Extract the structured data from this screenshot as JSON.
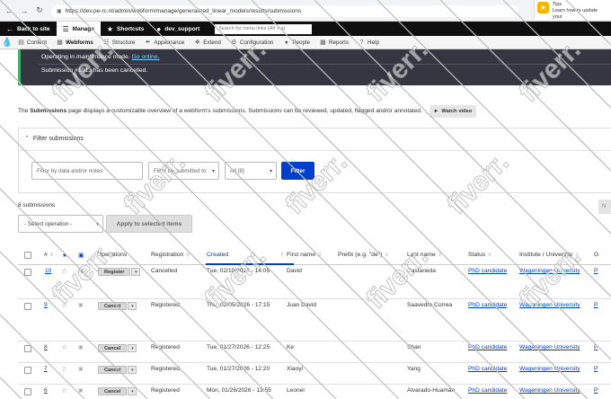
{
  "browser": {
    "url": "https://dev.pe-rc.nl/admin/webform/manage/generalized_linear_models/results/submissions",
    "notification": {
      "title": "Tips",
      "text": "Learn how to update your"
    }
  },
  "toolbar": {
    "back": "Back to site",
    "manage": "Manage",
    "shortcuts": "Shortcuts",
    "user": "dev_support",
    "search_placeholder": "Search for menu links (Alt + a)"
  },
  "tray": {
    "items": [
      "Content",
      "Webforms",
      "Structure",
      "Appearance",
      "Extend",
      "Configuration",
      "People",
      "Reports",
      "Help"
    ],
    "active": "Webforms"
  },
  "messages": {
    "maintenance": "Operating in maintenance mode.",
    "maintenance_link": "Go online.",
    "cancelled": "Submission #1913 has been cancelled."
  },
  "description": {
    "prefix": "The ",
    "bold": "Submissions",
    "text": " page displays a customizable overview of a webform's submissions. Submissions can be reviewed, updated, flagged and/or annotated.",
    "watch": "Watch video"
  },
  "filter": {
    "title": "Filter submissions",
    "keys_placeholder": "Filter by data and/or notes",
    "submitted_to": "Filter by submitted to",
    "state": "All [8]",
    "button": "Filter"
  },
  "count": "8 submissions",
  "bulk": {
    "operation": "- Select operation -",
    "apply": "Apply to selected items"
  },
  "right_stub": "N",
  "columns": [
    "#",
    "Operations",
    "Registration",
    "Created",
    "First name",
    "Prefix (e.g. \"de\")",
    "Last name",
    "Status",
    "Institute / University",
    "G"
  ],
  "rows": [
    {
      "sid": "10",
      "op": "Register",
      "registration": "Cancelled",
      "created": "Tue, 02/10/2026 - 14:05",
      "first": "David",
      "prefix": "",
      "last": "Castaneda",
      "status": "PhD candidate",
      "institute": "Wageningen University",
      "g": "P"
    },
    {
      "sid": "9",
      "op": "Cancel",
      "registration": "Registered",
      "created": "Thu, 02/05/2026 - 17:15",
      "first": "Juan David",
      "prefix": "",
      "last": "Saavedra Correa",
      "status": "PhD candidate",
      "institute": "Wageningen University",
      "g": "P"
    },
    {
      "sid": "8",
      "op": "Cancel",
      "registration": "Registered",
      "created": "Tue, 01/27/2026 - 12:25",
      "first": "Ke",
      "prefix": "",
      "last": "Shan",
      "status": "PhD candidate",
      "institute": "Wageningen University",
      "g": "P"
    },
    {
      "sid": "7",
      "op": "Cancel",
      "registration": "Registered",
      "created": "Tue, 01/27/2026 - 12:20",
      "first": "Xiaoyi",
      "prefix": "",
      "last": "Yang",
      "status": "PhD candidate",
      "institute": "Wageningen University",
      "g": "P"
    },
    {
      "sid": "6",
      "op": "Cancel",
      "registration": "Registered",
      "created": "Mon, 01/26/2026 - 13:55",
      "first": "Leonel",
      "prefix": "",
      "last": "Alvarado-Huamán",
      "status": "PhD candidate",
      "institute": "Wageningen University",
      "g": "P"
    }
  ],
  "watermark": "fiverr."
}
